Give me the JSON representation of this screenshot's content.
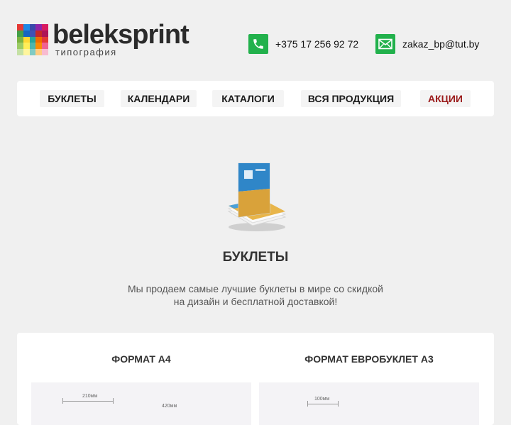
{
  "brand": {
    "name": "beleksprint",
    "subtitle": "типография",
    "mosaic_colors": [
      "#e53935",
      "#1e88e5",
      "#3949ab",
      "#8e24aa",
      "#d81b60",
      "#43a047",
      "#1565c0",
      "#3f51b5",
      "#c62828",
      "#ad1457",
      "#7cb342",
      "#fdd835",
      "#26a69a",
      "#ef6c00",
      "#e53935",
      "#9ccc65",
      "#ffee58",
      "#4db6ac",
      "#fb8c00",
      "#f06292",
      "#c5e1a5",
      "#fff59d",
      "#80cbc4",
      "#ffcc80",
      "#f8bbd0"
    ]
  },
  "contacts": {
    "phone": "+375 17 256 92 72",
    "email": "zakaz_bp@tut.by",
    "icon_color": "#22b14c"
  },
  "nav": {
    "items": [
      {
        "label": "БУКЛЕТЫ"
      },
      {
        "label": "КАЛЕНДАРИ"
      },
      {
        "label": "КАТАЛОГИ"
      },
      {
        "label": "ВСЯ ПРОДУКЦИЯ"
      },
      {
        "label": "АКЦИИ"
      }
    ],
    "sale_color": "#9b1c1c"
  },
  "hero": {
    "title": "БУКЛЕТЫ",
    "text_line1": "Мы продаем самые лучшие буклеты в мире со скидкой",
    "text_line2": "на дизайн и бесплатной доставкой!"
  },
  "formats": {
    "a4": {
      "title": "ФОРМАТ А4",
      "dim_width": "210мм",
      "dim_open": "420мм"
    },
    "a3": {
      "title": "ФОРМАТ ЕВРОБУКЛЕТ А3",
      "dim_width": "100мм"
    }
  }
}
